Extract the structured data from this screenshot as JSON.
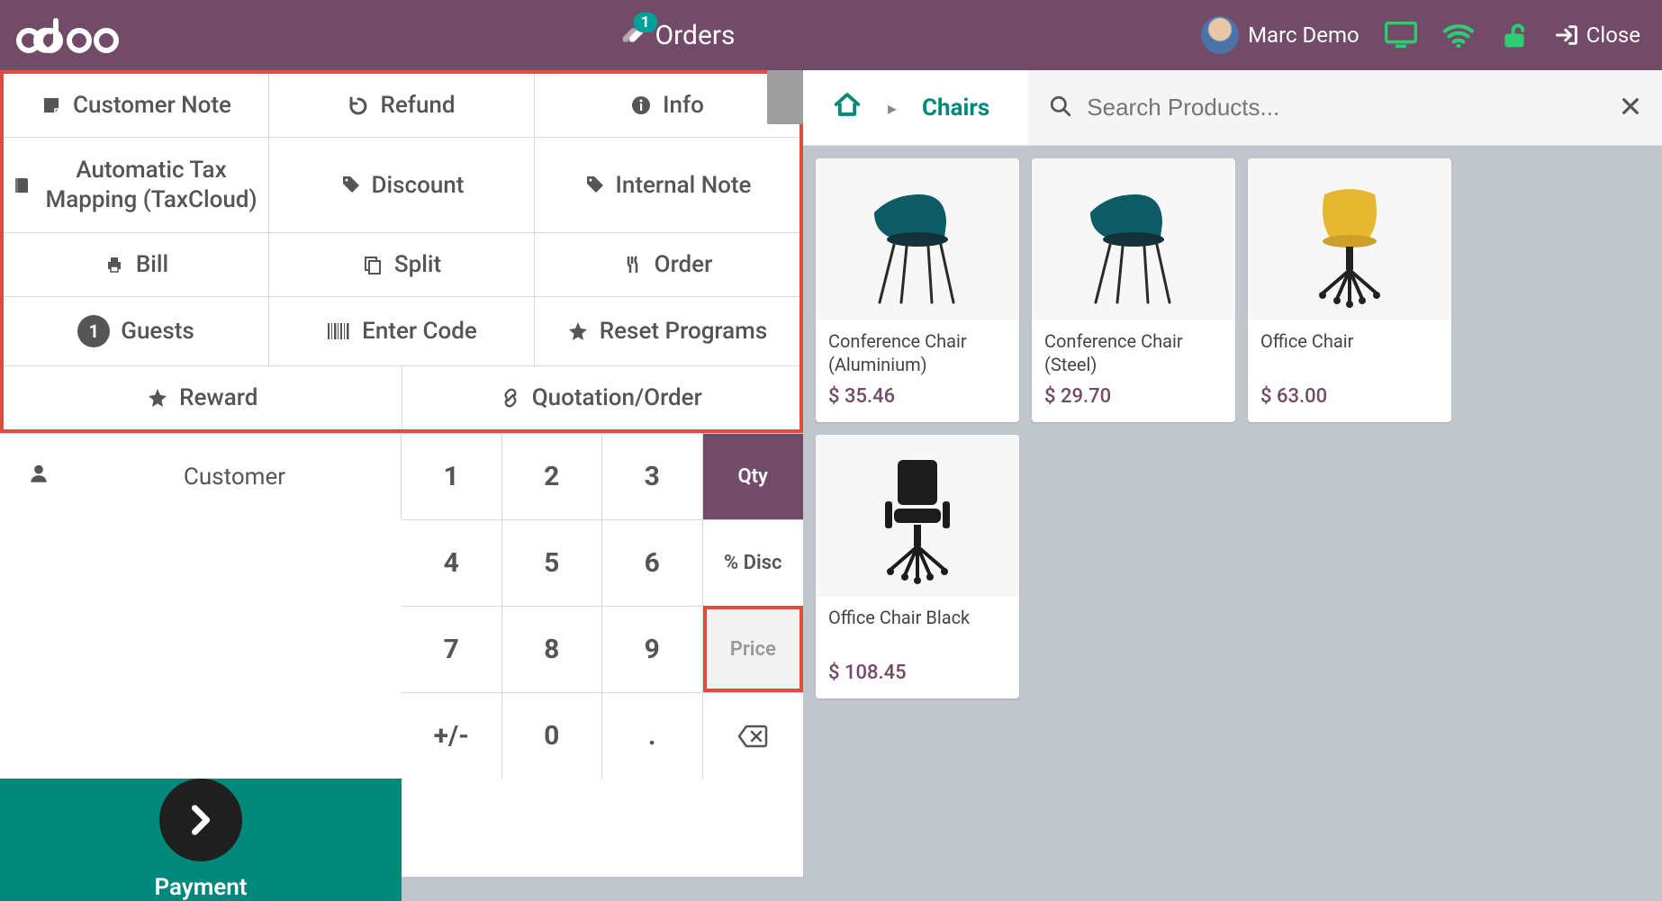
{
  "header": {
    "orders_label": "Orders",
    "orders_badge": "1",
    "user_name": "Marc Demo",
    "close_label": "Close"
  },
  "controlpad": {
    "customer_note": "Customer Note",
    "refund": "Refund",
    "info": "Info",
    "auto_tax": "Automatic Tax Mapping (TaxCloud)",
    "discount": "Discount",
    "internal_note": "Internal Note",
    "bill": "Bill",
    "split": "Split",
    "order": "Order",
    "guests": "Guests",
    "guests_count": "1",
    "enter_code": "Enter Code",
    "reset_programs": "Reset Programs",
    "reward": "Reward",
    "quotation_order": "Quotation/Order"
  },
  "left": {
    "customer_label": "Customer",
    "payment_label": "Payment"
  },
  "keypad": {
    "keys": [
      "1",
      "2",
      "3",
      "4",
      "5",
      "6",
      "7",
      "8",
      "9",
      "+/-",
      "0",
      "."
    ],
    "qty_label": "Qty",
    "disc_label": "% Disc",
    "price_label": "Price"
  },
  "breadcrumb": {
    "category": "Chairs"
  },
  "search": {
    "placeholder": "Search Products..."
  },
  "products": [
    {
      "name": "Conference Chair (Aluminium)",
      "price": "$ 35.46",
      "svg": "chair-teal-legs"
    },
    {
      "name": "Conference Chair (Steel)",
      "price": "$ 29.70",
      "svg": "chair-teal-legs"
    },
    {
      "name": "Office Chair",
      "price": "$ 63.00",
      "svg": "office-chair-yellow"
    },
    {
      "name": "Office Chair Black",
      "price": "$ 108.45",
      "svg": "office-chair-black"
    }
  ]
}
